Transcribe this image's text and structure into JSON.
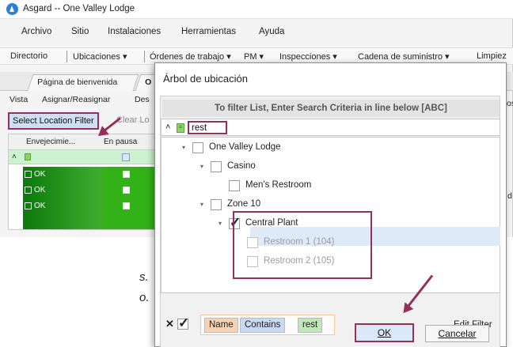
{
  "app": {
    "title": "Asgard -- One Valley Lodge"
  },
  "menu": [
    "Archivo",
    "Sitio",
    "Instalaciones",
    "Herramientas",
    "Ayuda"
  ],
  "toolbar": {
    "items": [
      "Directorio",
      "Ubicaciones ▾",
      "Órdenes de trabajo ▾",
      "PM ▾",
      "Inspecciones ▾",
      "Cadena de suministro ▾",
      "Limpiez"
    ]
  },
  "tabs": [
    {
      "label": "Página de bienvenida"
    },
    {
      "label": "O"
    }
  ],
  "actions": [
    "Vista",
    "Asignar/Reasignar",
    "Des"
  ],
  "location_filter": {
    "select_label": "Select Location Filter",
    "clear_label": "Clear Lo"
  },
  "grid": {
    "headers": [
      "Envejecimie...",
      "En pausa"
    ],
    "rows": [
      {
        "status": "OK"
      },
      {
        "status": "OK"
      },
      {
        "status": "OK"
      }
    ]
  },
  "background_text": [
    "s.",
    "o.",
    "os",
    "d"
  ],
  "dialog": {
    "title": "Árbol de ubicación",
    "filter_hint": "To filter List, Enter Search Criteria in line below [ABC]",
    "search": {
      "value": "rest"
    },
    "tree": [
      {
        "label": "One Valley Lodge",
        "checked": false,
        "muted": false
      },
      {
        "label": "Casino",
        "checked": false,
        "muted": false
      },
      {
        "label": "Men's Restroom",
        "checked": false,
        "muted": false
      },
      {
        "label": "Zone 10",
        "checked": false,
        "muted": false
      },
      {
        "label": "Central Plant",
        "checked": true,
        "muted": false
      },
      {
        "label": "Restroom 1 (104)",
        "checked": false,
        "muted": true
      },
      {
        "label": "Restroom 2 (105)",
        "checked": false,
        "muted": true
      }
    ],
    "criteria": {
      "field": "Name",
      "operator": "Contains",
      "value": "rest"
    },
    "edit_filter_label": "Edit Filter",
    "ok_label": "OK",
    "cancel_label": "Cancelar"
  },
  "colors": {
    "accent": "#93315a",
    "selection": "#dfeaf8",
    "grid_green": "#1f8f1a"
  }
}
